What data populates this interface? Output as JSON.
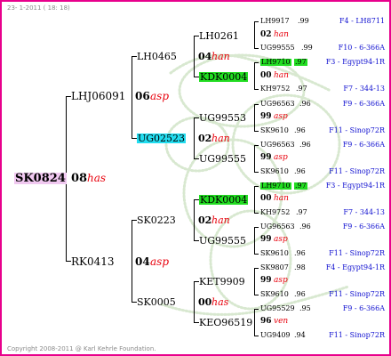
{
  "header": {
    "date": "23-  1-2011 ( 18: 18)"
  },
  "footer": {
    "copyright": "Copyright 2008-2011 @ Karl Kehrle Foundation."
  },
  "root": {
    "id": "SK0824",
    "year": "08",
    "breeder": "has"
  },
  "gen1": [
    {
      "id": "LHJ06091",
      "year": "06",
      "breeder": "asp"
    },
    {
      "id": "RK0413",
      "year": "04",
      "breeder": "asp"
    }
  ],
  "gen2": [
    {
      "id": "LH0465",
      "year": "04",
      "breeder": "han"
    },
    {
      "id": "UG02523",
      "year": "02",
      "breeder": "han"
    },
    {
      "id": "SK0223",
      "year": "02",
      "breeder": "han"
    },
    {
      "id": "SK0005",
      "year": "00",
      "breeder": "has"
    }
  ],
  "gen3": [
    {
      "id": "LH0261"
    },
    {
      "id": "KDK0004"
    },
    {
      "id": "UG99553"
    },
    {
      "id": "UG99555"
    },
    {
      "id": "KDK0004"
    },
    {
      "id": "UG99555"
    },
    {
      "id": "KET9909"
    },
    {
      "id": "KEO96519"
    }
  ],
  "gen4": [
    {
      "id": "LH9917",
      "year": ".99",
      "origin": "F4 - LH8711"
    },
    {
      "year": "02",
      "breeder": "han"
    },
    {
      "id": "UG99555",
      "year": ".99",
      "origin": "F10 - 6-366A"
    },
    {
      "id": "LH9710",
      "year": ".97",
      "origin": "F3 - Egypt94-1R"
    },
    {
      "year": "00",
      "breeder": "han"
    },
    {
      "id": "KH9752",
      "year": ".97",
      "origin": "F7 - 344-13"
    },
    {
      "id": "UG96563",
      "year": ".96",
      "origin": "F9 - 6-366A"
    },
    {
      "year": "99",
      "breeder": "asp"
    },
    {
      "id": "SK9610",
      "year": ".96",
      "origin": "F11 - Sinop72R"
    },
    {
      "id": "UG96563",
      "year": ".96",
      "origin": "F9 - 6-366A"
    },
    {
      "year": "99",
      "breeder": "asp"
    },
    {
      "id": "SK9610",
      "year": ".96",
      "origin": "F11 - Sinop72R"
    },
    {
      "id": "LH9710",
      "year": ".97",
      "origin": "F3 - Egypt94-1R"
    },
    {
      "year": "00",
      "breeder": "han"
    },
    {
      "id": "KH9752",
      "year": ".97",
      "origin": "F7 - 344-13"
    },
    {
      "id": "UG96563",
      "year": ".96",
      "origin": "F9 - 6-366A"
    },
    {
      "year": "99",
      "breeder": "asp"
    },
    {
      "id": "SK9610",
      "year": ".96",
      "origin": "F11 - Sinop72R"
    },
    {
      "id": "SK9807",
      "year": ".98",
      "origin": "F4 - Egypt94-1R"
    },
    {
      "year": "99",
      "breeder": "asp"
    },
    {
      "id": "SK9610",
      "year": ".96",
      "origin": "F11 - Sinop72R"
    },
    {
      "id": "UG95529",
      "year": ".95",
      "origin": "F9 - 6-366A"
    },
    {
      "year": "96",
      "breeder": "ven"
    },
    {
      "id": "UG9409",
      "year": ".94",
      "origin": "F11 - Sinop72R"
    }
  ],
  "colors": {
    "border": "#e8008c",
    "breeder": "#e8000c",
    "origin": "#1010d0",
    "highlight_green": "#22dd22",
    "highlight_cyan": "#22ddf0",
    "highlight_pink": "#f0c8f0"
  },
  "watermark": "bee-icon"
}
